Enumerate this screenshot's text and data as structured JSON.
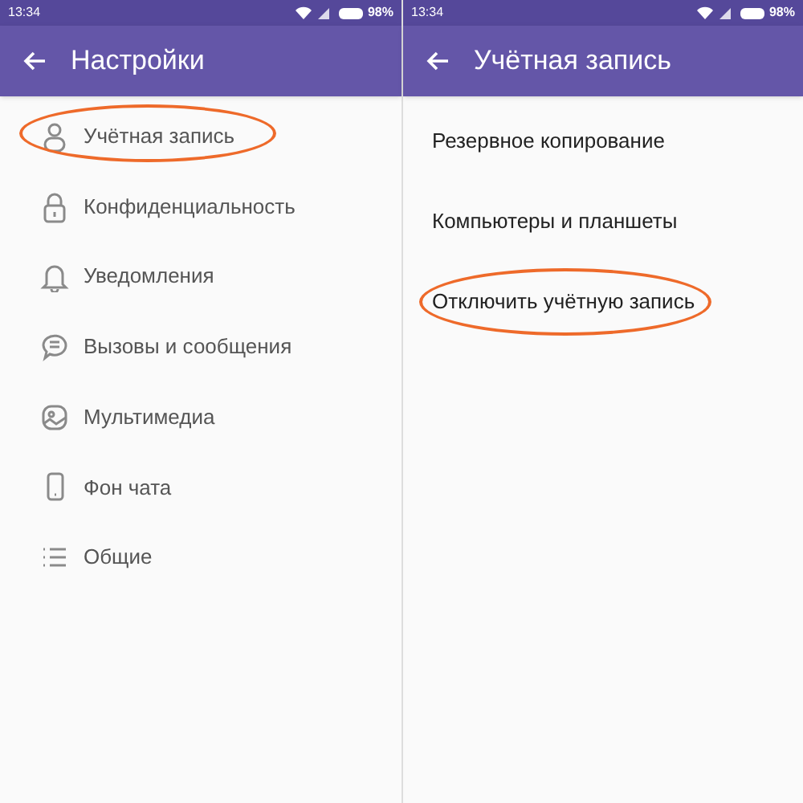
{
  "screens": [
    {
      "status_bar": {
        "time": "13:34",
        "battery": "98%"
      },
      "app_bar": {
        "title": "Настройки"
      },
      "items": [
        {
          "label": "Учётная запись",
          "circled": true
        },
        {
          "label": "Конфиденциальность",
          "circled": false
        },
        {
          "label": "Уведомления",
          "circled": false
        },
        {
          "label": "Вызовы и сообщения",
          "circled": false
        },
        {
          "label": "Мультимедиа",
          "circled": false
        },
        {
          "label": "Фон чата",
          "circled": false
        },
        {
          "label": "Общие",
          "circled": false
        }
      ]
    },
    {
      "status_bar": {
        "time": "13:34",
        "battery": "98%"
      },
      "app_bar": {
        "title": "Учётная запись"
      },
      "items": [
        {
          "label": "Резервное копирование",
          "circled": false
        },
        {
          "label": "Компьютеры и планшеты",
          "circled": false
        },
        {
          "label": "Отключить учётную запись",
          "circled": true
        }
      ]
    }
  ]
}
